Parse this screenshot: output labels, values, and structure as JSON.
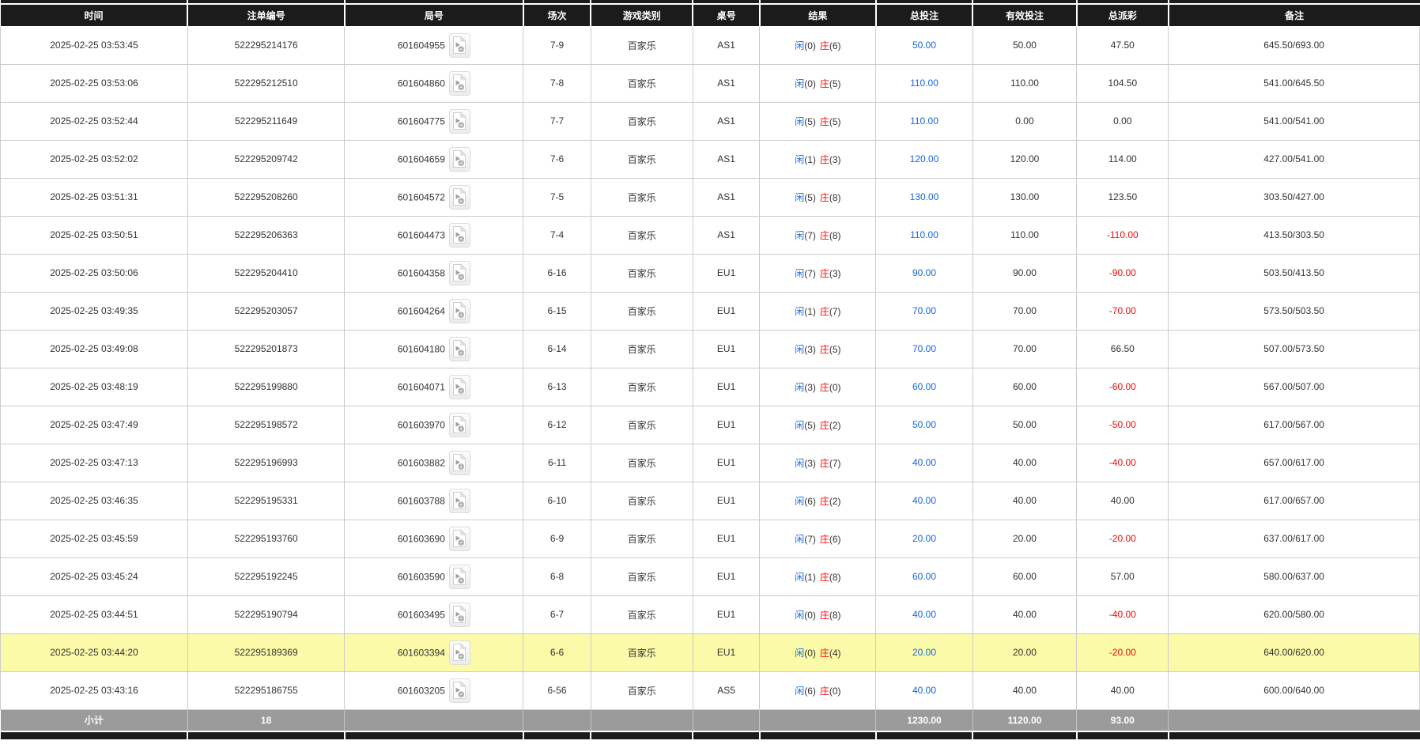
{
  "colors": {
    "header_bg": "#1b1b1b",
    "footer_bg": "#9b9b9b",
    "grid_line": "#cccccc",
    "highlight_row": "#fafaa8",
    "player_blue": "#1766e0",
    "banker_red": "#ef0b0b",
    "bet_amount_blue": "#1766e0",
    "negative_red": "#ef0b0b"
  },
  "table": {
    "columns": [
      "时间",
      "注单编号",
      "局号",
      "场次",
      "游戏类别",
      "桌号",
      "结果",
      "总投注",
      "有效投注",
      "总派彩",
      "备注"
    ],
    "result_labels": {
      "player": "闲",
      "banker": "庄"
    },
    "video_icon": "video-replay-icon",
    "rows": [
      {
        "time": "2025-02-25 03:53:45",
        "bet_id": "522295214176",
        "round_id": "601604955",
        "session": "7-9",
        "game_type": "百家乐",
        "table_id": "AS1",
        "player_count": 0,
        "banker_count": 6,
        "total_bet": "50.00",
        "valid_bet": "50.00",
        "payout": "47.50",
        "remark": "645.50/693.00",
        "highlighted": false
      },
      {
        "time": "2025-02-25 03:53:06",
        "bet_id": "522295212510",
        "round_id": "601604860",
        "session": "7-8",
        "game_type": "百家乐",
        "table_id": "AS1",
        "player_count": 0,
        "banker_count": 5,
        "total_bet": "110.00",
        "valid_bet": "110.00",
        "payout": "104.50",
        "remark": "541.00/645.50",
        "highlighted": false
      },
      {
        "time": "2025-02-25 03:52:44",
        "bet_id": "522295211649",
        "round_id": "601604775",
        "session": "7-7",
        "game_type": "百家乐",
        "table_id": "AS1",
        "player_count": 5,
        "banker_count": 5,
        "total_bet": "110.00",
        "valid_bet": "0.00",
        "payout": "0.00",
        "remark": "541.00/541.00",
        "highlighted": false
      },
      {
        "time": "2025-02-25 03:52:02",
        "bet_id": "522295209742",
        "round_id": "601604659",
        "session": "7-6",
        "game_type": "百家乐",
        "table_id": "AS1",
        "player_count": 1,
        "banker_count": 3,
        "total_bet": "120.00",
        "valid_bet": "120.00",
        "payout": "114.00",
        "remark": "427.00/541.00",
        "highlighted": false
      },
      {
        "time": "2025-02-25 03:51:31",
        "bet_id": "522295208260",
        "round_id": "601604572",
        "session": "7-5",
        "game_type": "百家乐",
        "table_id": "AS1",
        "player_count": 5,
        "banker_count": 8,
        "total_bet": "130.00",
        "valid_bet": "130.00",
        "payout": "123.50",
        "remark": "303.50/427.00",
        "highlighted": false
      },
      {
        "time": "2025-02-25 03:50:51",
        "bet_id": "522295206363",
        "round_id": "601604473",
        "session": "7-4",
        "game_type": "百家乐",
        "table_id": "AS1",
        "player_count": 7,
        "banker_count": 8,
        "total_bet": "110.00",
        "valid_bet": "110.00",
        "payout": "-110.00",
        "remark": "413.50/303.50",
        "highlighted": false
      },
      {
        "time": "2025-02-25 03:50:06",
        "bet_id": "522295204410",
        "round_id": "601604358",
        "session": "6-16",
        "game_type": "百家乐",
        "table_id": "EU1",
        "player_count": 7,
        "banker_count": 3,
        "total_bet": "90.00",
        "valid_bet": "90.00",
        "payout": "-90.00",
        "remark": "503.50/413.50",
        "highlighted": false
      },
      {
        "time": "2025-02-25 03:49:35",
        "bet_id": "522295203057",
        "round_id": "601604264",
        "session": "6-15",
        "game_type": "百家乐",
        "table_id": "EU1",
        "player_count": 1,
        "banker_count": 7,
        "total_bet": "70.00",
        "valid_bet": "70.00",
        "payout": "-70.00",
        "remark": "573.50/503.50",
        "highlighted": false
      },
      {
        "time": "2025-02-25 03:49:08",
        "bet_id": "522295201873",
        "round_id": "601604180",
        "session": "6-14",
        "game_type": "百家乐",
        "table_id": "EU1",
        "player_count": 3,
        "banker_count": 5,
        "total_bet": "70.00",
        "valid_bet": "70.00",
        "payout": "66.50",
        "remark": "507.00/573.50",
        "highlighted": false
      },
      {
        "time": "2025-02-25 03:48:19",
        "bet_id": "522295199880",
        "round_id": "601604071",
        "session": "6-13",
        "game_type": "百家乐",
        "table_id": "EU1",
        "player_count": 3,
        "banker_count": 0,
        "total_bet": "60.00",
        "valid_bet": "60.00",
        "payout": "-60.00",
        "remark": "567.00/507.00",
        "highlighted": false
      },
      {
        "time": "2025-02-25 03:47:49",
        "bet_id": "522295198572",
        "round_id": "601603970",
        "session": "6-12",
        "game_type": "百家乐",
        "table_id": "EU1",
        "player_count": 5,
        "banker_count": 2,
        "total_bet": "50.00",
        "valid_bet": "50.00",
        "payout": "-50.00",
        "remark": "617.00/567.00",
        "highlighted": false
      },
      {
        "time": "2025-02-25 03:47:13",
        "bet_id": "522295196993",
        "round_id": "601603882",
        "session": "6-11",
        "game_type": "百家乐",
        "table_id": "EU1",
        "player_count": 3,
        "banker_count": 7,
        "total_bet": "40.00",
        "valid_bet": "40.00",
        "payout": "-40.00",
        "remark": "657.00/617.00",
        "highlighted": false
      },
      {
        "time": "2025-02-25 03:46:35",
        "bet_id": "522295195331",
        "round_id": "601603788",
        "session": "6-10",
        "game_type": "百家乐",
        "table_id": "EU1",
        "player_count": 6,
        "banker_count": 2,
        "total_bet": "40.00",
        "valid_bet": "40.00",
        "payout": "40.00",
        "remark": "617.00/657.00",
        "highlighted": false
      },
      {
        "time": "2025-02-25 03:45:59",
        "bet_id": "522295193760",
        "round_id": "601603690",
        "session": "6-9",
        "game_type": "百家乐",
        "table_id": "EU1",
        "player_count": 7,
        "banker_count": 6,
        "total_bet": "20.00",
        "valid_bet": "20.00",
        "payout": "-20.00",
        "remark": "637.00/617.00",
        "highlighted": false
      },
      {
        "time": "2025-02-25 03:45:24",
        "bet_id": "522295192245",
        "round_id": "601603590",
        "session": "6-8",
        "game_type": "百家乐",
        "table_id": "EU1",
        "player_count": 1,
        "banker_count": 8,
        "total_bet": "60.00",
        "valid_bet": "60.00",
        "payout": "57.00",
        "remark": "580.00/637.00",
        "highlighted": false
      },
      {
        "time": "2025-02-25 03:44:51",
        "bet_id": "522295190794",
        "round_id": "601603495",
        "session": "6-7",
        "game_type": "百家乐",
        "table_id": "EU1",
        "player_count": 0,
        "banker_count": 8,
        "total_bet": "40.00",
        "valid_bet": "40.00",
        "payout": "-40.00",
        "remark": "620.00/580.00",
        "highlighted": false
      },
      {
        "time": "2025-02-25 03:44:20",
        "bet_id": "522295189369",
        "round_id": "601603394",
        "session": "6-6",
        "game_type": "百家乐",
        "table_id": "EU1",
        "player_count": 0,
        "banker_count": 4,
        "total_bet": "20.00",
        "valid_bet": "20.00",
        "payout": "-20.00",
        "remark": "640.00/620.00",
        "highlighted": true
      },
      {
        "time": "2025-02-25 03:43:16",
        "bet_id": "522295186755",
        "round_id": "601603205",
        "session": "6-56",
        "game_type": "百家乐",
        "table_id": "AS5",
        "player_count": 6,
        "banker_count": 0,
        "total_bet": "40.00",
        "valid_bet": "40.00",
        "payout": "40.00",
        "remark": "600.00/640.00",
        "highlighted": false
      }
    ],
    "footer": {
      "label": "小计",
      "count": "18",
      "total_bet": "1230.00",
      "valid_bet": "1120.00",
      "payout": "93.00"
    }
  }
}
